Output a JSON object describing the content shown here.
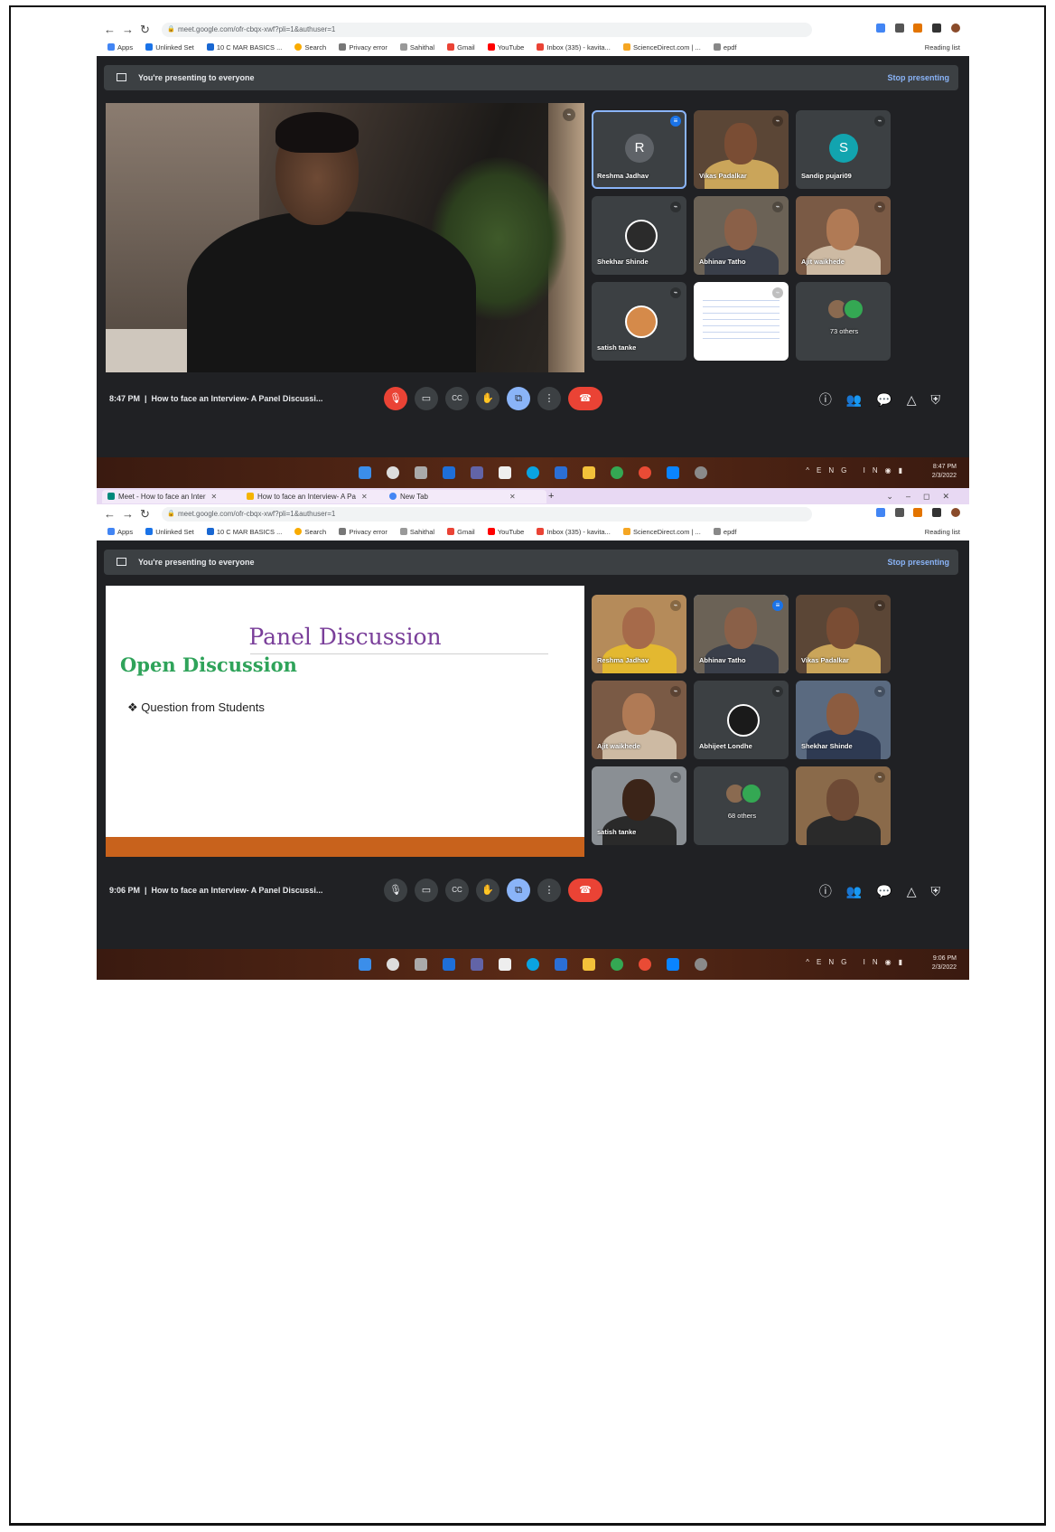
{
  "shot1": {
    "address": "meet.google.com/ofr-cbqx-xwf?pli=1&authuser=1",
    "bookmarks": [
      "Apps",
      "Unlinked Set",
      "10 C MAR BASICS ...",
      "Search",
      "Privacy error",
      "Sahithal",
      "Gmail",
      "YouTube",
      "Inbox (335) - kavita...",
      "ScienceDirect.com | ...",
      "epdf"
    ],
    "reading_list": "Reading list",
    "present_text": "You're presenting to everyone",
    "stop_presenting": "Stop presenting",
    "tiles": [
      {
        "name": "Reshma Jadhav",
        "kind": "avatar",
        "initial": "R",
        "color": "#5f6368",
        "speaking": true
      },
      {
        "name": "Vikas Padalkar",
        "kind": "video",
        "skin": "#7a4d34",
        "bg": "#5b4636",
        "shirt": "#caa55a"
      },
      {
        "name": "Sandip pujari09",
        "kind": "avatar",
        "initial": "S",
        "color": "#12a4af"
      },
      {
        "name": "Shekhar Shinde",
        "kind": "photo",
        "color": "#2b2b2b"
      },
      {
        "name": "Abhinav Tatho",
        "kind": "video",
        "skin": "#8a6048",
        "bg": "#6b6256",
        "shirt": "#3a3f4a"
      },
      {
        "name": "Ajit waikhede",
        "kind": "video",
        "skin": "#b07a55",
        "bg": "#7a5a45",
        "shirt": "#cdbaa3"
      },
      {
        "name": "satish tanke",
        "kind": "photo",
        "color": "#d58a4a"
      },
      {
        "name": "",
        "kind": "slide"
      },
      {
        "name": "73 others",
        "kind": "others"
      }
    ],
    "time": "8:47 PM",
    "meeting_title": "How to face an Interview- A Panel Discussi...",
    "tray_time": "8:47 PM",
    "tray_date": "2/3/2022",
    "tray_lang": "ENG IN"
  },
  "shot2": {
    "tabs": [
      "Meet - How to face an Inter",
      "How to face an Interview- A Pa",
      "New Tab"
    ],
    "address": "meet.google.com/ofr-cbqx-xwf?pli=1&authuser=1",
    "bookmarks": [
      "Apps",
      "Unlinked Set",
      "10 C MAR BASICS ...",
      "Search",
      "Privacy error",
      "Sahithal",
      "Gmail",
      "YouTube",
      "Inbox (335) - kavita...",
      "ScienceDirect.com | ...",
      "epdf"
    ],
    "reading_list": "Reading list",
    "present_text": "You're presenting to everyone",
    "stop_presenting": "Stop presenting",
    "slide": {
      "title": "Panel Discussion",
      "subtitle": "Open Discussion",
      "bullet": "❖ Question from Students"
    },
    "tiles": [
      {
        "name": "Reshma Jadhav",
        "kind": "video",
        "skin": "#a66a4a",
        "bg": "#b58b5a",
        "shirt": "#e3b830"
      },
      {
        "name": "Abhinav Tatho",
        "kind": "video",
        "skin": "#8a6048",
        "bg": "#6b6256",
        "shirt": "#3a3f4a",
        "speaking": true
      },
      {
        "name": "Vikas Padalkar",
        "kind": "video",
        "skin": "#7a4d34",
        "bg": "#5b4636",
        "shirt": "#caa55a"
      },
      {
        "name": "Ajit waikhede",
        "kind": "video",
        "skin": "#b07a55",
        "bg": "#7a5a45",
        "shirt": "#cdbaa3"
      },
      {
        "name": "Abhijeet Londhe",
        "kind": "photo",
        "color": "#1a1a1a"
      },
      {
        "name": "Shekhar Shinde",
        "kind": "video",
        "skin": "#8c5c40",
        "bg": "#5a6a80",
        "shirt": "#2e3a52"
      },
      {
        "name": "satish tanke",
        "kind": "video",
        "skin": "#3b2418",
        "bg": "#8a8f94",
        "shirt": "#2a2a2a"
      },
      {
        "name": "68 others",
        "kind": "others"
      },
      {
        "name": "",
        "kind": "video",
        "skin": "#6e4a35",
        "bg": "#8a6a4a",
        "shirt": "#2a2a2a"
      }
    ],
    "time": "9:06 PM",
    "meeting_title": "How to face an Interview- A Panel Discussi...",
    "tray_time": "9:06 PM",
    "tray_date": "2/3/2022",
    "tray_lang": "ENG IN"
  },
  "icons": {
    "mic_off": "🎙",
    "camera": "▭",
    "captions": "CC",
    "hand": "✋",
    "present": "⧉",
    "more": "⋮",
    "end_call": "☎",
    "info": "ⓘ",
    "people": "👥",
    "chat": "💬",
    "activities": "△",
    "host": "⛨"
  }
}
